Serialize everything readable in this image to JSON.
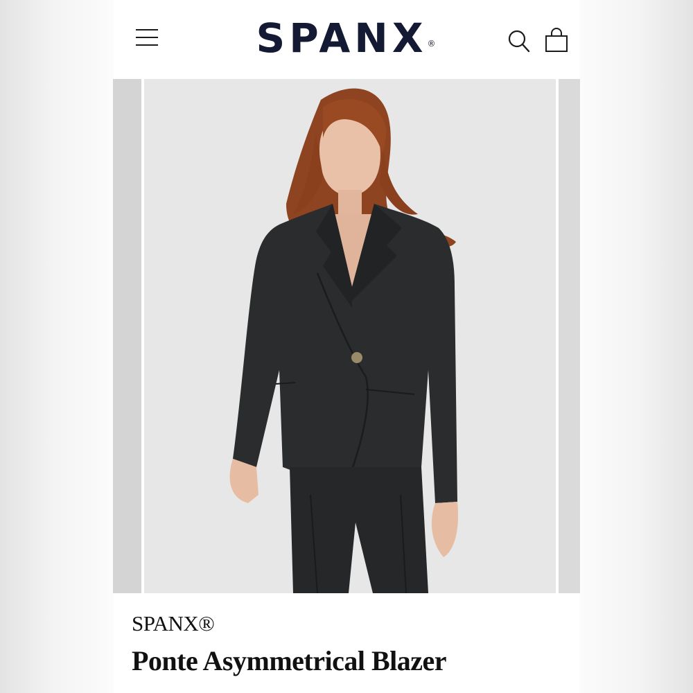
{
  "header": {
    "logo_text": "SPANX",
    "logo_mark": "®",
    "menu_icon": "hamburger-menu-icon",
    "search_icon": "search-icon",
    "bag_icon": "shopping-bag-icon"
  },
  "gallery": {
    "image_alt": "Model wearing charcoal double-breasted asymmetrical blazer with matching pants"
  },
  "product": {
    "brand": "SPANX®",
    "title": "Ponte Asymmetrical Blazer"
  },
  "colors": {
    "logo": "#141a33",
    "blazer": "#2b2c2d",
    "hair": "#9a4a22",
    "background": "#e6e7e6"
  }
}
